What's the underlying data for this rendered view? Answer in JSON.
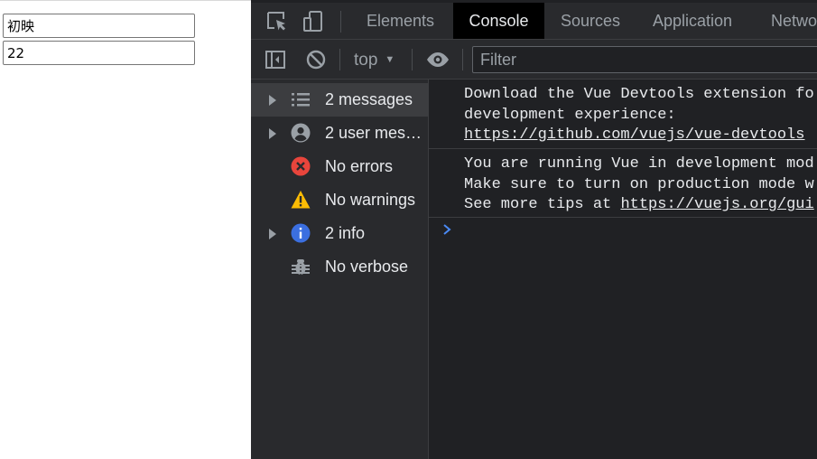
{
  "page": {
    "name_value": "初映",
    "age_value": "22"
  },
  "devtools": {
    "tabs": [
      {
        "label": "Elements"
      },
      {
        "label": "Console"
      },
      {
        "label": "Sources"
      },
      {
        "label": "Application"
      },
      {
        "label": "Netwo"
      }
    ],
    "active_tab": "Console",
    "toolbar": {
      "context": "top",
      "filter_placeholder": "Filter"
    },
    "sidebar": {
      "items": [
        {
          "label": "2 messages",
          "icon": "list-icon",
          "expandable": true,
          "selected": true
        },
        {
          "label": "2 user mess...",
          "icon": "user-icon",
          "expandable": true,
          "selected": false
        },
        {
          "label": "No errors",
          "icon": "error-icon",
          "expandable": false,
          "selected": false
        },
        {
          "label": "No warnings",
          "icon": "warning-icon",
          "expandable": false,
          "selected": false
        },
        {
          "label": "2 info",
          "icon": "info-icon",
          "expandable": true,
          "selected": false
        },
        {
          "label": "No verbose",
          "icon": "bug-icon",
          "expandable": false,
          "selected": false
        }
      ]
    },
    "console": {
      "messages": [
        {
          "line1": "Download the Vue Devtools extension fo",
          "line2": "development experience:",
          "link": "https://github.com/vuejs/vue-devtools"
        },
        {
          "line1": "You are running Vue in development mod",
          "line2": "Make sure to turn on production mode w",
          "line3_text": "See more tips at ",
          "line3_link": "https://vuejs.org/gui"
        }
      ]
    }
  },
  "colors": {
    "panel_bg": "#292a2d",
    "console_bg": "#202124",
    "active_tab_bg": "#000000",
    "text": "#e8eaed",
    "muted_text": "#9aa0a6",
    "error_red": "#e8453c",
    "warning_yellow": "#fbbc04",
    "info_blue": "#3b6fe0",
    "prompt_blue": "#4a8af4"
  }
}
